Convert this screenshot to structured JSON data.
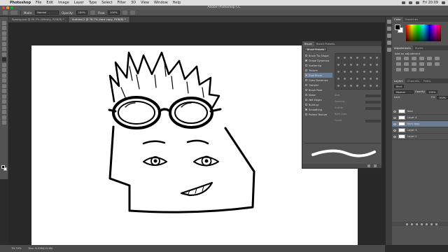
{
  "menubar": {
    "apple": "",
    "app": "Photoshop",
    "items": [
      "File",
      "Edit",
      "Image",
      "Layer",
      "Type",
      "Select",
      "Filter",
      "3D",
      "View",
      "Window",
      "Help"
    ],
    "clock": "Fri 20:09"
  },
  "window": {
    "title": "Adobe Photoshop CC"
  },
  "options": {
    "mode_label": "Mode:",
    "mode_value": "Normal",
    "opacity_label": "Opacity:",
    "opacity_value": "100%",
    "flow_label": "Flow:",
    "flow_value": "100%"
  },
  "tabs": [
    {
      "label": "Spooky.psd @ 95.5% (Whisky, RGB/8) *"
    },
    {
      "label": "Untitled-2 @ 78.7% (face copy, RGB/8) *"
    }
  ],
  "status": {
    "zoom": "78.74%",
    "doc": "Doc: 6.59M/15.8M"
  },
  "brush_panel": {
    "tabs": [
      "Brush",
      "Brush Presets"
    ],
    "preset_button": "Brush Presets",
    "options": [
      {
        "label": "Brush Tip Shape",
        "on": false,
        "hi": false
      },
      {
        "label": "Shape Dynamics",
        "on": true,
        "hi": false
      },
      {
        "label": "Scattering",
        "on": false,
        "hi": false
      },
      {
        "label": "Texture",
        "on": false,
        "hi": false
      },
      {
        "label": "Dual Brush",
        "on": true,
        "hi": true
      },
      {
        "label": "Color Dynamics",
        "on": false,
        "hi": false
      },
      {
        "label": "Transfer",
        "on": false,
        "hi": false
      },
      {
        "label": "Brush Pose",
        "on": false,
        "hi": false
      },
      {
        "label": "Noise",
        "on": false,
        "hi": false
      },
      {
        "label": "Wet Edges",
        "on": false,
        "hi": false
      },
      {
        "label": "Build-up",
        "on": false,
        "hi": false
      },
      {
        "label": "Smoothing",
        "on": true,
        "hi": false
      },
      {
        "label": "Protect Texture",
        "on": false,
        "hi": false
      }
    ],
    "sliders": [
      "Size",
      "Spacing",
      "Scatter",
      "Both Axes",
      "Count"
    ]
  },
  "panels": {
    "color_tabs": [
      "Color",
      "Swatches"
    ],
    "adjust_tabs": [
      "Adjustments",
      "Styles"
    ],
    "adjust_label": "Add an adjustment",
    "layers_tabs": [
      "Layers",
      "Channels",
      "Paths"
    ],
    "kind_label": "Kind",
    "blend_mode": "Normal",
    "opacity_label": "Opacity:",
    "opacity_value": "100%",
    "lock_label": "Lock:",
    "fill_label": "Fill:",
    "fill_value": "100%",
    "layers": [
      {
        "name": "face",
        "selected": false
      },
      {
        "name": "Layer 4",
        "selected": false
      },
      {
        "name": "face copy",
        "selected": true
      },
      {
        "name": "Layer 3",
        "selected": false
      },
      {
        "name": "Layer 2",
        "selected": false
      }
    ]
  },
  "colors": {
    "accent_selected": "#6a7d95",
    "panel": "#535353",
    "canvas_bg": "#282828"
  }
}
